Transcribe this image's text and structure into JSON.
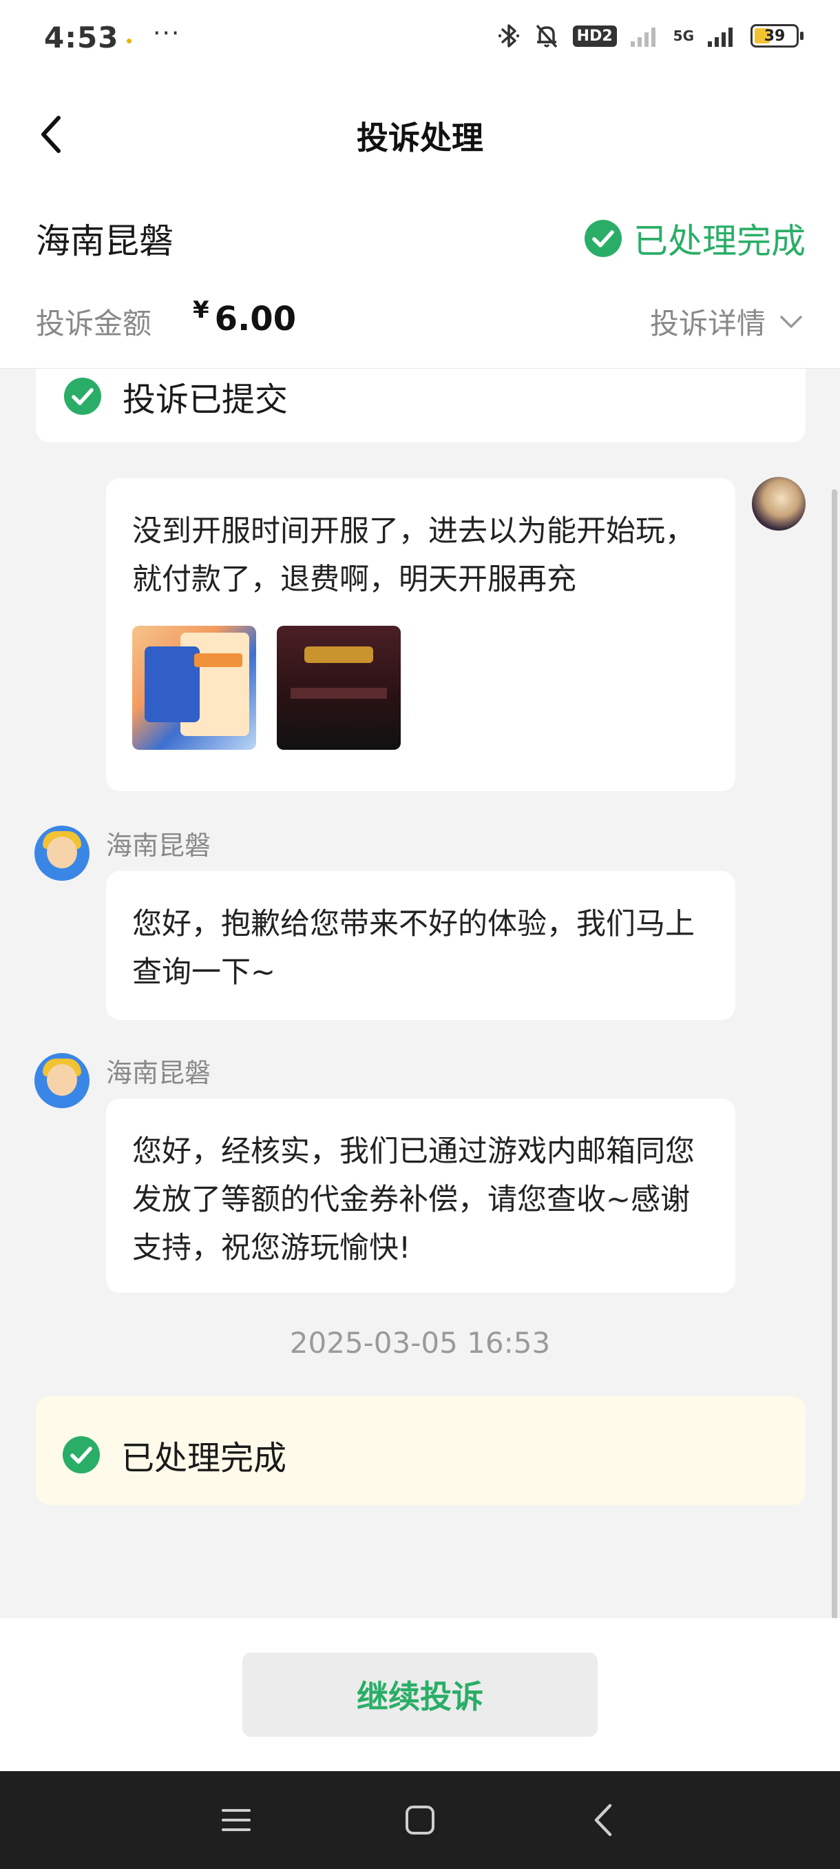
{
  "status_bar": {
    "time": "4:53",
    "more": "···",
    "hd_badge": "HD2",
    "network": "5G",
    "battery": "39"
  },
  "nav": {
    "title": "投诉处理"
  },
  "header": {
    "merchant_name": "海南昆磐",
    "status": "已处理完成",
    "amount_label": "投诉金额",
    "currency": "¥",
    "amount": "6.00",
    "detail_label": "投诉详情"
  },
  "timeline": {
    "submitted_label": "投诉已提交"
  },
  "messages": [
    {
      "sender": "user",
      "text": "没到开服时间开服了，进去以为能开始玩，就付款了，退费啊，明天开服再充",
      "attachments": [
        "screenshot-1",
        "screenshot-2"
      ]
    },
    {
      "sender": "海南昆磐",
      "text": "您好，抱歉给您带来不好的体验，我们马上查询一下~"
    },
    {
      "sender": "海南昆磐",
      "text": "您好，经核实，我们已通过游戏内邮箱同您发放了等额的代金券补偿，请您查收~感谢支持，祝您游玩愉快!"
    }
  ],
  "timestamp": "2025-03-05 16:53",
  "result_label": "已处理完成",
  "action": {
    "continue_label": "继续投诉"
  },
  "colors": {
    "accent_green": "#2aae67",
    "result_bg": "#fffaea",
    "page_bg": "#f3f3f3"
  },
  "icons": {
    "back": "chevron-left-icon",
    "status_check": "check-circle-icon",
    "expand": "chevron-down-icon",
    "system_menu": "menu-icon",
    "system_home": "home-icon",
    "system_back": "back-icon"
  }
}
